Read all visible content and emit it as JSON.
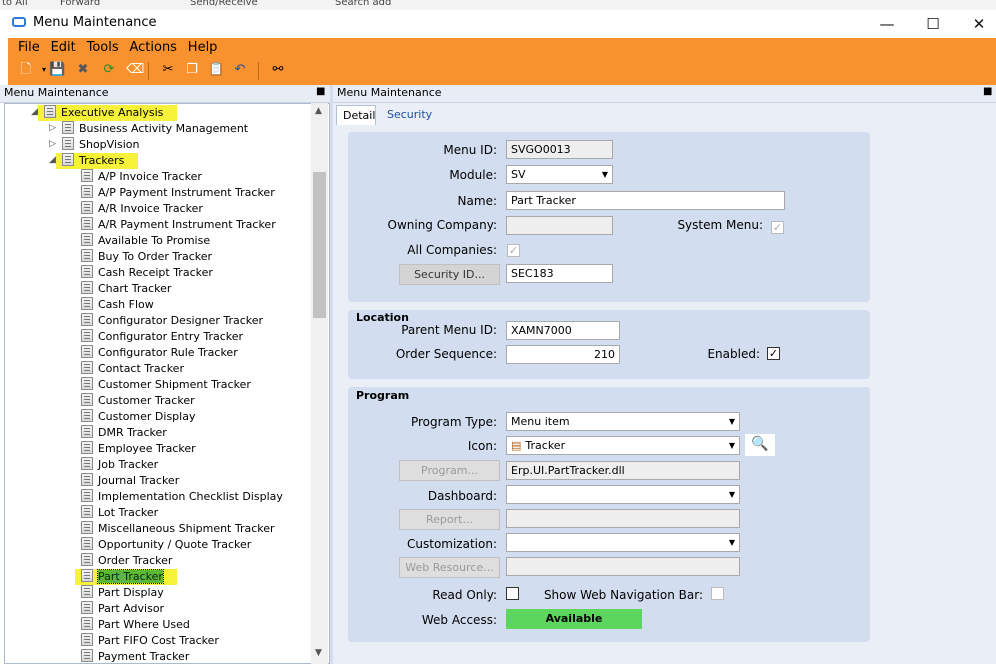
{
  "background_strip": {
    "items": [
      "to All",
      "Forward",
      "Send/Receive",
      "Search add"
    ]
  },
  "window": {
    "title": "Menu Maintenance",
    "minimize": "—",
    "maximize": "☐",
    "close": "✕"
  },
  "menu": [
    "File",
    "Edit",
    "Tools",
    "Actions",
    "Help"
  ],
  "left_panel": {
    "header": "Menu Maintenance",
    "pin": "■"
  },
  "tree": [
    {
      "label": "Executive Analysis",
      "level": 0,
      "expander": "◢",
      "highlight": true
    },
    {
      "label": "Business Activity Management",
      "level": 1,
      "expander": "▷",
      "highlight": false
    },
    {
      "label": "ShopVision",
      "level": 1,
      "expander": "▷",
      "highlight": false
    },
    {
      "label": "Trackers",
      "level": 1,
      "expander": "◢",
      "highlight": true
    },
    {
      "label": "A/P Invoice Tracker",
      "level": 2
    },
    {
      "label": "A/P Payment Instrument Tracker",
      "level": 2
    },
    {
      "label": "A/R Invoice Tracker",
      "level": 2
    },
    {
      "label": "A/R Payment Instrument Tracker",
      "level": 2
    },
    {
      "label": "Available To Promise",
      "level": 2
    },
    {
      "label": "Buy To Order Tracker",
      "level": 2
    },
    {
      "label": "Cash Receipt Tracker",
      "level": 2
    },
    {
      "label": "Chart Tracker",
      "level": 2
    },
    {
      "label": "Cash Flow",
      "level": 2
    },
    {
      "label": "Configurator Designer Tracker",
      "level": 2
    },
    {
      "label": "Configurator Entry Tracker",
      "level": 2
    },
    {
      "label": "Configurator Rule Tracker",
      "level": 2
    },
    {
      "label": "Contact Tracker",
      "level": 2
    },
    {
      "label": "Customer Shipment Tracker",
      "level": 2
    },
    {
      "label": "Customer Tracker",
      "level": 2
    },
    {
      "label": "Customer Display",
      "level": 2
    },
    {
      "label": "DMR Tracker",
      "level": 2
    },
    {
      "label": "Employee Tracker",
      "level": 2
    },
    {
      "label": "Job Tracker",
      "level": 2
    },
    {
      "label": "Journal Tracker",
      "level": 2
    },
    {
      "label": "Implementation Checklist Display",
      "level": 2
    },
    {
      "label": "Lot Tracker",
      "level": 2
    },
    {
      "label": "Miscellaneous Shipment Tracker",
      "level": 2
    },
    {
      "label": "Opportunity / Quote Tracker",
      "level": 2
    },
    {
      "label": "Order Tracker",
      "level": 2
    },
    {
      "label": "Part Tracker",
      "level": 2,
      "highlight": true,
      "selected": true
    },
    {
      "label": "Part Display",
      "level": 2
    },
    {
      "label": "Part Advisor",
      "level": 2
    },
    {
      "label": "Part Where Used",
      "level": 2
    },
    {
      "label": "Part FIFO Cost Tracker",
      "level": 2
    },
    {
      "label": "Payment Tracker",
      "level": 2
    }
  ],
  "right_panel": {
    "header": "Menu Maintenance",
    "pin": "■",
    "tabs": [
      "Detail",
      "Security"
    ]
  },
  "detail": {
    "menu_id_label": "Menu ID:",
    "menu_id": "SVGO0013",
    "module_label": "Module:",
    "module": "SV",
    "name_label": "Name:",
    "name": "Part Tracker",
    "owning_company_label": "Owning Company:",
    "owning_company": "",
    "system_menu_label": "System Menu:",
    "system_menu": "✓",
    "all_companies_label": "All Companies:",
    "all_companies": "✓",
    "security_id_button": "Security ID...",
    "security_id": "SEC183"
  },
  "location": {
    "title": "Location",
    "parent_menu_id_label": "Parent Menu ID:",
    "parent_menu_id": "XAMN7000",
    "order_sequence_label": "Order Sequence:",
    "order_sequence": "210",
    "enabled_label": "Enabled:",
    "enabled": "✓"
  },
  "program": {
    "title": "Program",
    "program_type_label": "Program Type:",
    "program_type": "Menu item",
    "icon_label": "Icon:",
    "icon": "Tracker",
    "program_button": "Program...",
    "program": "Erp.UI.PartTracker.dll",
    "dashboard_label": "Dashboard:",
    "dashboard": "",
    "report_button": "Report...",
    "report": "",
    "customization_label": "Customization:",
    "customization": "",
    "web_resource_button": "Web Resource...",
    "web_resource": "",
    "read_only_label": "Read Only:",
    "show_web_nav_label": "Show Web Navigation Bar:",
    "web_access_label": "Web Access:",
    "web_access": "Available"
  },
  "colors": {
    "accent_orange": "#f7922f",
    "highlight_yellow": "#f6f23a",
    "available_green": "#5cd65c"
  }
}
